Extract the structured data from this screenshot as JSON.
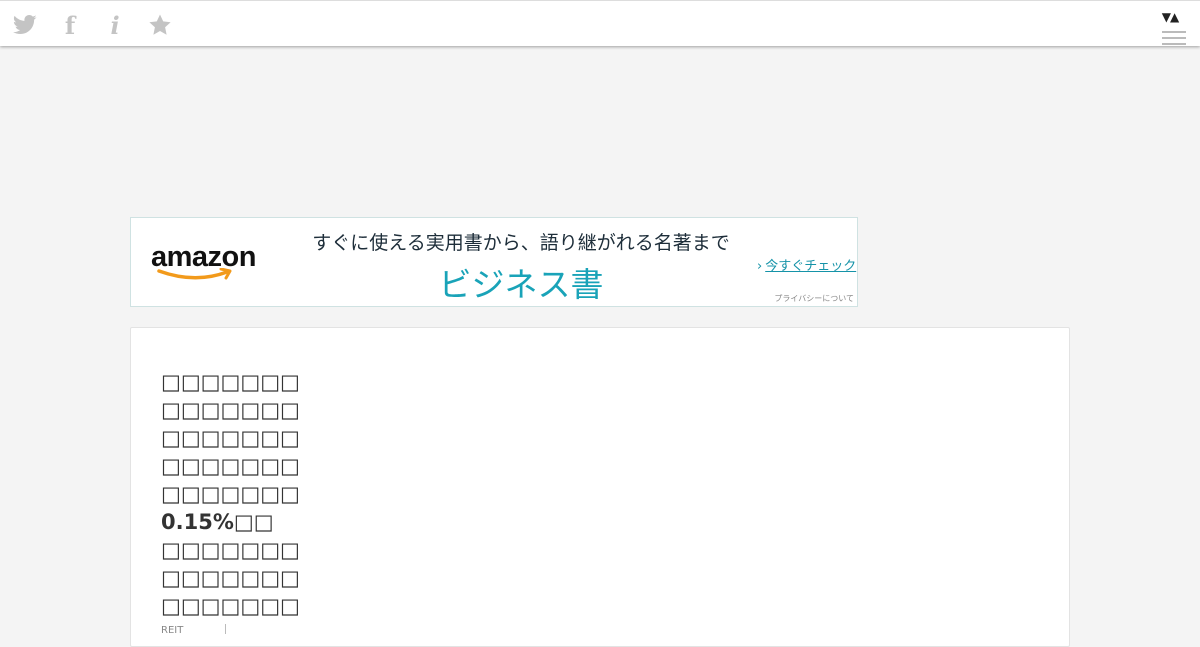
{
  "topbar": {
    "icons": [
      "twitter-icon",
      "facebook-icon",
      "info-icon",
      "star-icon"
    ],
    "facebook_glyph": "f",
    "info_glyph": "i",
    "toggle_glyph": "▼▲"
  },
  "ad": {
    "logo": "amazon",
    "headline": "すぐに使える実用書から、語り継がれる名著まで",
    "big_text": "ビジネス書",
    "cta": "今すぐチェック",
    "cta_arrow": "›",
    "privacy": "プライバシーについて",
    "accent_color": "#19a3b8"
  },
  "article": {
    "lines": [
      "□□□□□□□",
      "□□□□□□□",
      "□□□□□□□",
      "□□□□□□□",
      "□□□□□□□",
      "0.15%□□",
      "□□□□□□□",
      "□□□□□□□",
      "□□□□□□□"
    ],
    "footer": "REIT"
  }
}
